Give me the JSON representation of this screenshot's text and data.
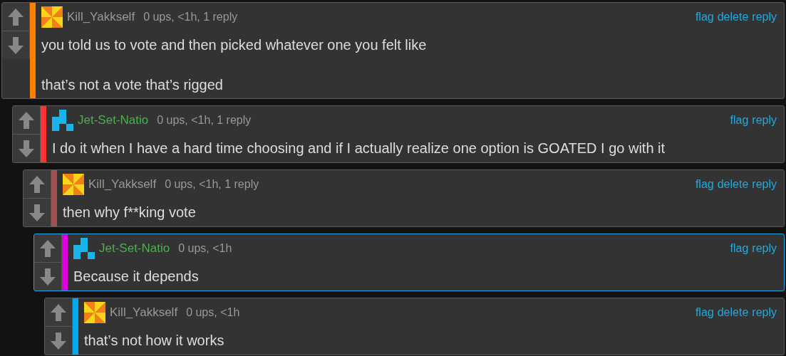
{
  "thread": [
    {
      "kind": "pinwheel",
      "author": {
        "name": "Kill_Yakkself",
        "color": "#999999"
      },
      "meta": "0 ups, <1h, 1 reply",
      "actions": [
        "flag",
        "delete",
        "reply"
      ],
      "color": "#ff8000",
      "highlighted": false,
      "paragraphs": [
        "you told us to vote and then picked whatever one you felt like",
        "that’s not a vote that’s rigged"
      ],
      "children": [
        {
          "kind": "blocks",
          "author": {
            "name": "Jet-Set-Natio",
            "color": "#4cb04c"
          },
          "meta": "0 ups, <1h, 1 reply",
          "actions": [
            "flag",
            "reply"
          ],
          "color": "#ff3333",
          "highlighted": false,
          "paragraphs": [
            "I do it when I have a hard time choosing and if I actually realize one option is GOATED I go with it"
          ],
          "children": [
            {
              "kind": "pinwheel",
              "author": {
                "name": "Kill_Yakkself",
                "color": "#999999"
              },
              "meta": "0 ups, <1h, 1 reply",
              "actions": [
                "flag",
                "delete",
                "reply"
              ],
              "color": "#a05050",
              "highlighted": false,
              "paragraphs": [
                "then why f**king vote"
              ],
              "children": [
                {
                  "kind": "blocks",
                  "author": {
                    "name": "Jet-Set-Natio",
                    "color": "#4cb04c"
                  },
                  "meta": "0 ups, <1h",
                  "actions": [
                    "flag",
                    "reply"
                  ],
                  "color": "#dd00dd",
                  "highlighted": true,
                  "paragraphs": [
                    "Because it depends"
                  ],
                  "children": [
                    {
                      "kind": "pinwheel",
                      "author": {
                        "name": "Kill_Yakkself",
                        "color": "#999999"
                      },
                      "meta": "0 ups, <1h",
                      "actions": [
                        "flag",
                        "delete",
                        "reply"
                      ],
                      "color": "#00aaee",
                      "highlighted": false,
                      "paragraphs": [
                        "that’s not how it works"
                      ]
                    }
                  ]
                }
              ]
            }
          ]
        }
      ]
    }
  ]
}
